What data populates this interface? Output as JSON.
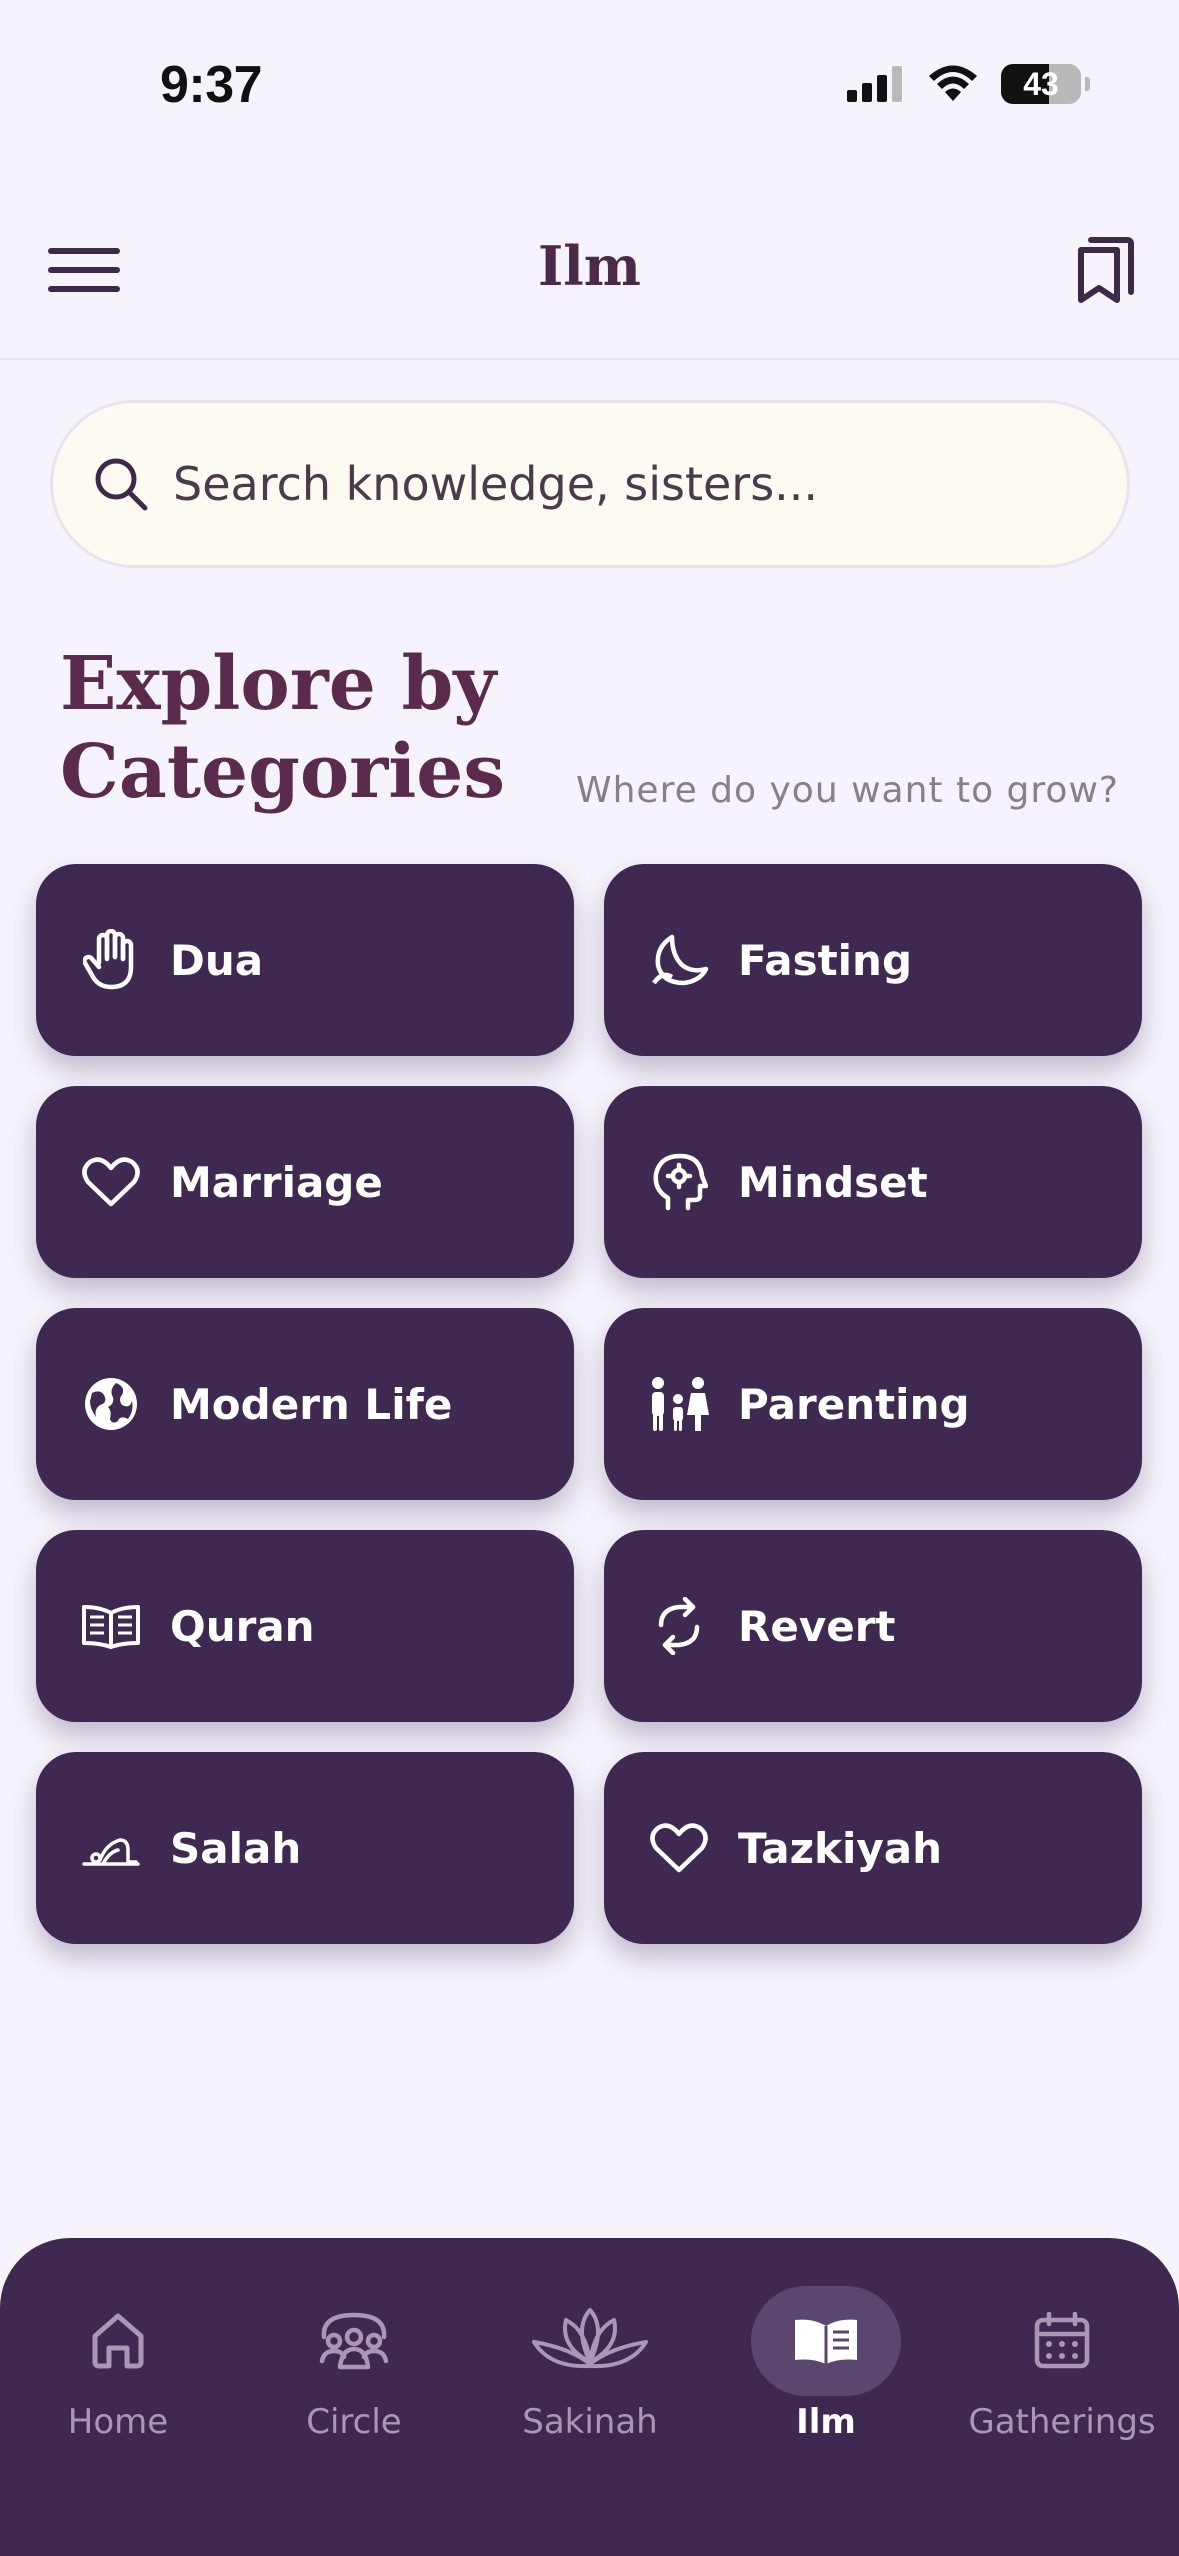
{
  "status": {
    "time": "9:37",
    "battery": "43"
  },
  "header": {
    "title": "Ilm"
  },
  "search": {
    "placeholder": "Search knowledge, sisters..."
  },
  "section": {
    "title": "Explore by Categories",
    "subtitle": "Where do you want to grow?"
  },
  "categories": [
    {
      "label": "Dua",
      "icon": "raised-hand-icon"
    },
    {
      "label": "Fasting",
      "icon": "crescent-moon-icon"
    },
    {
      "label": "Marriage",
      "icon": "heart-icon"
    },
    {
      "label": "Mindset",
      "icon": "head-gear-icon"
    },
    {
      "label": "Modern Life",
      "icon": "globe-icon"
    },
    {
      "label": "Parenting",
      "icon": "family-icon"
    },
    {
      "label": "Quran",
      "icon": "open-book-icon"
    },
    {
      "label": "Revert",
      "icon": "refresh-icon"
    },
    {
      "label": "Salah",
      "icon": "prostration-icon"
    },
    {
      "label": "Tazkiyah",
      "icon": "heart-icon"
    }
  ],
  "nav": {
    "items": [
      {
        "label": "Home",
        "icon": "home-icon"
      },
      {
        "label": "Circle",
        "icon": "users-icon"
      },
      {
        "label": "Sakinah",
        "icon": "lotus-icon"
      },
      {
        "label": "Ilm",
        "icon": "book-icon",
        "active": true
      },
      {
        "label": "Gatherings",
        "icon": "calendar-icon"
      }
    ]
  },
  "colors": {
    "accent": "#3f2950",
    "title": "#5a2b4c",
    "background": "#f6f3fc",
    "search_bg": "#fdfaf2"
  }
}
